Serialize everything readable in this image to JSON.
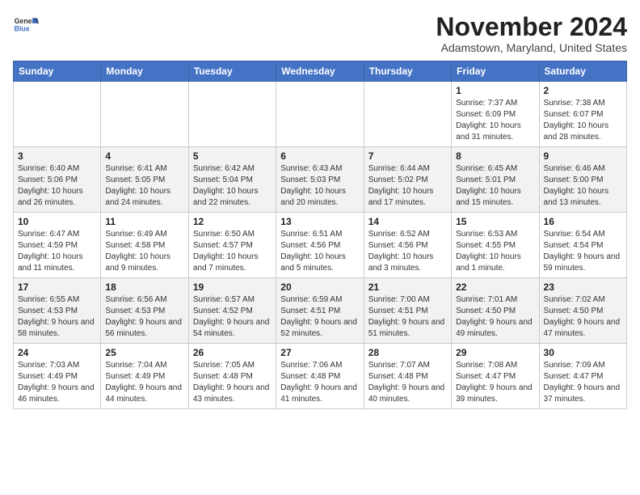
{
  "header": {
    "logo_line1": "General",
    "logo_line2": "Blue",
    "month": "November 2024",
    "location": "Adamstown, Maryland, United States"
  },
  "days_of_week": [
    "Sunday",
    "Monday",
    "Tuesday",
    "Wednesday",
    "Thursday",
    "Friday",
    "Saturday"
  ],
  "weeks": [
    [
      {
        "day": "",
        "info": ""
      },
      {
        "day": "",
        "info": ""
      },
      {
        "day": "",
        "info": ""
      },
      {
        "day": "",
        "info": ""
      },
      {
        "day": "",
        "info": ""
      },
      {
        "day": "1",
        "info": "Sunrise: 7:37 AM\nSunset: 6:09 PM\nDaylight: 10 hours and 31 minutes."
      },
      {
        "day": "2",
        "info": "Sunrise: 7:38 AM\nSunset: 6:07 PM\nDaylight: 10 hours and 28 minutes."
      }
    ],
    [
      {
        "day": "3",
        "info": "Sunrise: 6:40 AM\nSunset: 5:06 PM\nDaylight: 10 hours and 26 minutes."
      },
      {
        "day": "4",
        "info": "Sunrise: 6:41 AM\nSunset: 5:05 PM\nDaylight: 10 hours and 24 minutes."
      },
      {
        "day": "5",
        "info": "Sunrise: 6:42 AM\nSunset: 5:04 PM\nDaylight: 10 hours and 22 minutes."
      },
      {
        "day": "6",
        "info": "Sunrise: 6:43 AM\nSunset: 5:03 PM\nDaylight: 10 hours and 20 minutes."
      },
      {
        "day": "7",
        "info": "Sunrise: 6:44 AM\nSunset: 5:02 PM\nDaylight: 10 hours and 17 minutes."
      },
      {
        "day": "8",
        "info": "Sunrise: 6:45 AM\nSunset: 5:01 PM\nDaylight: 10 hours and 15 minutes."
      },
      {
        "day": "9",
        "info": "Sunrise: 6:46 AM\nSunset: 5:00 PM\nDaylight: 10 hours and 13 minutes."
      }
    ],
    [
      {
        "day": "10",
        "info": "Sunrise: 6:47 AM\nSunset: 4:59 PM\nDaylight: 10 hours and 11 minutes."
      },
      {
        "day": "11",
        "info": "Sunrise: 6:49 AM\nSunset: 4:58 PM\nDaylight: 10 hours and 9 minutes."
      },
      {
        "day": "12",
        "info": "Sunrise: 6:50 AM\nSunset: 4:57 PM\nDaylight: 10 hours and 7 minutes."
      },
      {
        "day": "13",
        "info": "Sunrise: 6:51 AM\nSunset: 4:56 PM\nDaylight: 10 hours and 5 minutes."
      },
      {
        "day": "14",
        "info": "Sunrise: 6:52 AM\nSunset: 4:56 PM\nDaylight: 10 hours and 3 minutes."
      },
      {
        "day": "15",
        "info": "Sunrise: 6:53 AM\nSunset: 4:55 PM\nDaylight: 10 hours and 1 minute."
      },
      {
        "day": "16",
        "info": "Sunrise: 6:54 AM\nSunset: 4:54 PM\nDaylight: 9 hours and 59 minutes."
      }
    ],
    [
      {
        "day": "17",
        "info": "Sunrise: 6:55 AM\nSunset: 4:53 PM\nDaylight: 9 hours and 58 minutes."
      },
      {
        "day": "18",
        "info": "Sunrise: 6:56 AM\nSunset: 4:53 PM\nDaylight: 9 hours and 56 minutes."
      },
      {
        "day": "19",
        "info": "Sunrise: 6:57 AM\nSunset: 4:52 PM\nDaylight: 9 hours and 54 minutes."
      },
      {
        "day": "20",
        "info": "Sunrise: 6:59 AM\nSunset: 4:51 PM\nDaylight: 9 hours and 52 minutes."
      },
      {
        "day": "21",
        "info": "Sunrise: 7:00 AM\nSunset: 4:51 PM\nDaylight: 9 hours and 51 minutes."
      },
      {
        "day": "22",
        "info": "Sunrise: 7:01 AM\nSunset: 4:50 PM\nDaylight: 9 hours and 49 minutes."
      },
      {
        "day": "23",
        "info": "Sunrise: 7:02 AM\nSunset: 4:50 PM\nDaylight: 9 hours and 47 minutes."
      }
    ],
    [
      {
        "day": "24",
        "info": "Sunrise: 7:03 AM\nSunset: 4:49 PM\nDaylight: 9 hours and 46 minutes."
      },
      {
        "day": "25",
        "info": "Sunrise: 7:04 AM\nSunset: 4:49 PM\nDaylight: 9 hours and 44 minutes."
      },
      {
        "day": "26",
        "info": "Sunrise: 7:05 AM\nSunset: 4:48 PM\nDaylight: 9 hours and 43 minutes."
      },
      {
        "day": "27",
        "info": "Sunrise: 7:06 AM\nSunset: 4:48 PM\nDaylight: 9 hours and 41 minutes."
      },
      {
        "day": "28",
        "info": "Sunrise: 7:07 AM\nSunset: 4:48 PM\nDaylight: 9 hours and 40 minutes."
      },
      {
        "day": "29",
        "info": "Sunrise: 7:08 AM\nSunset: 4:47 PM\nDaylight: 9 hours and 39 minutes."
      },
      {
        "day": "30",
        "info": "Sunrise: 7:09 AM\nSunset: 4:47 PM\nDaylight: 9 hours and 37 minutes."
      }
    ]
  ]
}
